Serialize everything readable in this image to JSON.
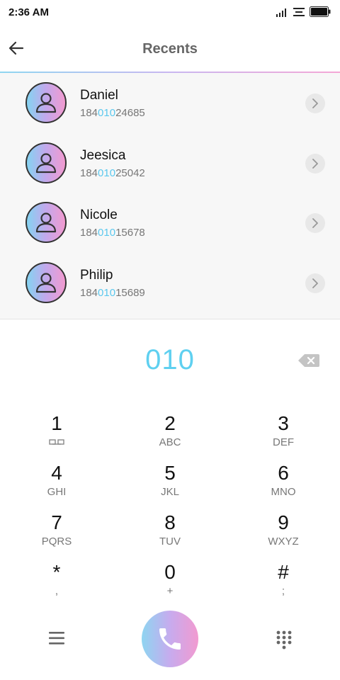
{
  "status_bar": {
    "time": "2:36 AM",
    "icons": [
      "signal-icon",
      "menu-status-icon",
      "battery-icon"
    ]
  },
  "app_bar": {
    "title": "Recents",
    "back_icon": "arrow-left-icon"
  },
  "recents": [
    {
      "name": "Daniel",
      "number_prefix": "184",
      "number_match": "010",
      "number_suffix": "24685"
    },
    {
      "name": "Jeesica",
      "number_prefix": "184",
      "number_match": "010",
      "number_suffix": "25042"
    },
    {
      "name": "Nicole",
      "number_prefix": "184",
      "number_match": "010",
      "number_suffix": "15678"
    },
    {
      "name": "Philip",
      "number_prefix": "184",
      "number_match": "010",
      "number_suffix": "15689"
    }
  ],
  "dial_display": {
    "number": "010",
    "backspace_icon": "backspace-icon"
  },
  "keypad": [
    {
      "digit": "1",
      "letters": ""
    },
    {
      "digit": "2",
      "letters": "ABC"
    },
    {
      "digit": "3",
      "letters": "DEF"
    },
    {
      "digit": "4",
      "letters": "GHI"
    },
    {
      "digit": "5",
      "letters": "JKL"
    },
    {
      "digit": "6",
      "letters": "MNO"
    },
    {
      "digit": "7",
      "letters": "PQRS"
    },
    {
      "digit": "8",
      "letters": "TUV"
    },
    {
      "digit": "9",
      "letters": "WXYZ"
    },
    {
      "digit": "*",
      "letters": ","
    },
    {
      "digit": "0",
      "letters": "+"
    },
    {
      "digit": "#",
      "letters": ";"
    }
  ],
  "bottom_bar": {
    "menu_icon": "hamburger-menu-icon",
    "call_icon": "phone-icon",
    "keypad_icon": "dialpad-icon"
  },
  "colors": {
    "accent_blue": "#5fd0f0",
    "accent_pink": "#f29ad0",
    "list_background": "#f7f7f7"
  }
}
